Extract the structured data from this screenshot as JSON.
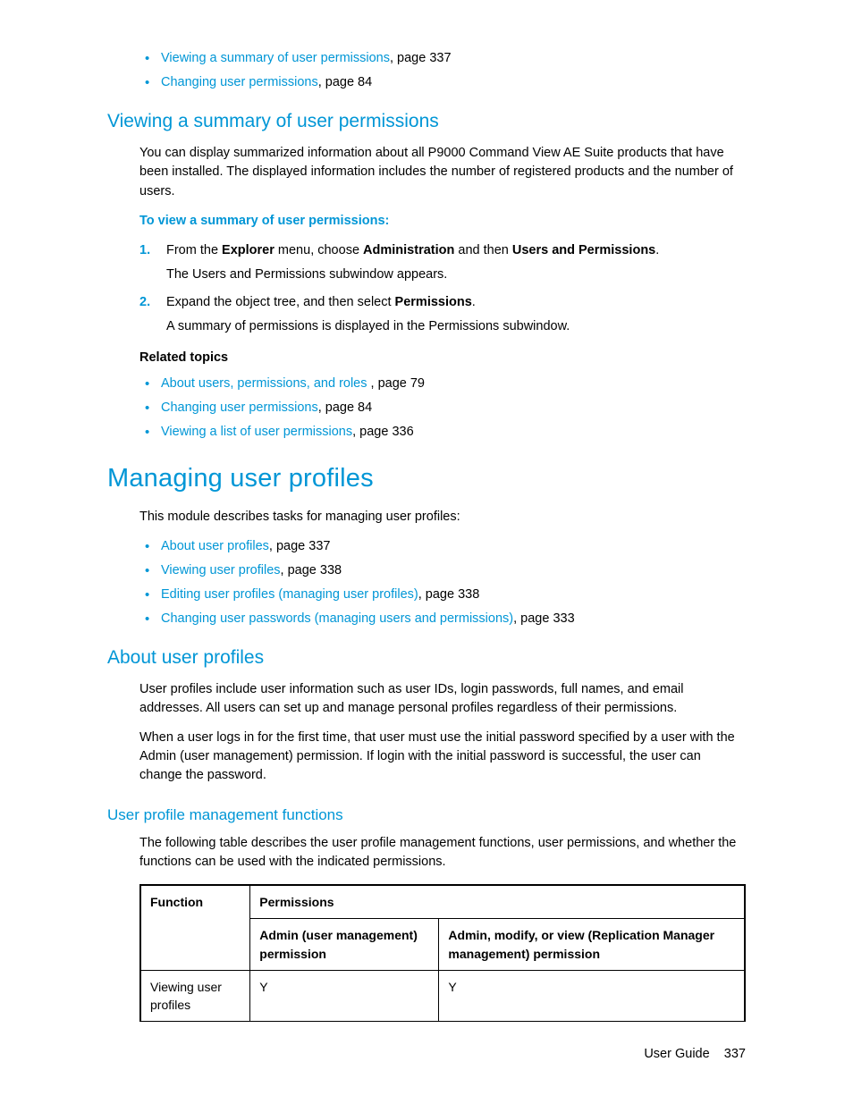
{
  "top_links": [
    {
      "link": "Viewing a summary of user permissions",
      "suffix": ", page 337"
    },
    {
      "link": "Changing user permissions",
      "suffix": ", page 84"
    }
  ],
  "section_viewing": {
    "title": "Viewing a summary of user permissions",
    "intro": "You can display summarized information about all P9000 Command View AE Suite products that have been installed. The displayed information includes the number of registered products and the number of users.",
    "proc_title": "To view a summary of user permissions:",
    "steps": [
      {
        "pre": "From the ",
        "b1": "Explorer",
        "mid1": " menu, choose ",
        "b2": "Administration",
        "mid2": " and then ",
        "b3": "Users and Permissions",
        "post": ".",
        "sub": "The Users and Permissions subwindow appears."
      },
      {
        "pre": "Expand the object tree, and then select ",
        "b1": "Permissions",
        "post": ".",
        "sub": "A summary of permissions is displayed in the Permissions subwindow."
      }
    ],
    "related_title": "Related topics",
    "related": [
      {
        "link": "About users, permissions, and roles",
        "suffix": " , page 79"
      },
      {
        "link": "Changing user permissions",
        "suffix": ", page 84"
      },
      {
        "link": "Viewing a list of user permissions",
        "suffix": ", page 336"
      }
    ]
  },
  "section_managing": {
    "title": "Managing user profiles",
    "intro": "This module describes tasks for managing user profiles:",
    "links": [
      {
        "link": "About user profiles",
        "suffix": ", page 337"
      },
      {
        "link": "Viewing user profiles",
        "suffix": ", page 338"
      },
      {
        "link": "Editing user profiles (managing user profiles)",
        "suffix": ", page 338"
      },
      {
        "link": "Changing user passwords (managing users and permissions)",
        "suffix": ", page 333"
      }
    ]
  },
  "section_about": {
    "title": "About user profiles",
    "p1": "User profiles include user information such as user IDs, login passwords, full names, and email addresses. All users can set up and manage personal profiles regardless of their permissions.",
    "p2": "When a user logs in for the first time, that user must use the initial password specified by a user with the Admin (user management) permission. If login with the initial password is successful, the user can change the password."
  },
  "section_funcs": {
    "title": "User profile management functions",
    "intro": "The following table describes the user profile management functions, user permissions, and whether the functions can be used with the indicated permissions.",
    "table": {
      "head_function": "Function",
      "head_permissions": "Permissions",
      "head_col1": "Admin (user management) permission",
      "head_col2": "Admin, modify, or view (Replication Manager management) permission",
      "rows": [
        {
          "func": "Viewing user profiles",
          "c1": "Y",
          "c2": "Y"
        }
      ]
    }
  },
  "footer": {
    "label": "User Guide",
    "page": "337"
  }
}
